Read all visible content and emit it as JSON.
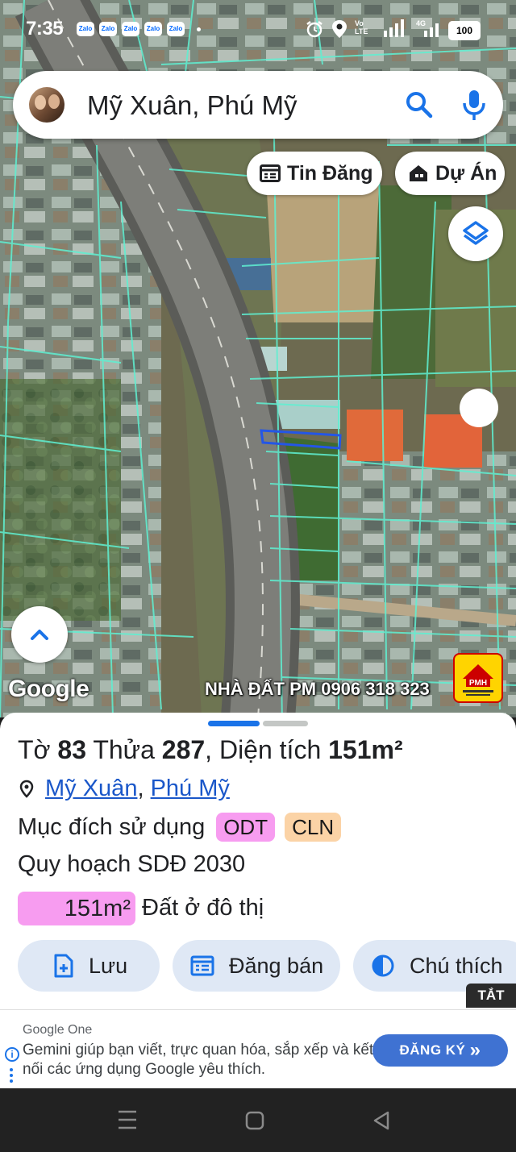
{
  "status_bar": {
    "time": "7:35",
    "notification_apps": [
      "Zalo",
      "Zalo",
      "Zalo",
      "Zalo",
      "Zalo"
    ],
    "network_label": "Vo LTE",
    "data_label": "4G",
    "battery": "100",
    "icons": [
      "alarm-icon",
      "location-icon",
      "signal-icon",
      "battery-icon"
    ]
  },
  "search": {
    "query": "Mỹ Xuân, Phú Mỹ",
    "icons": [
      "avatar",
      "search-icon",
      "mic-icon"
    ]
  },
  "chips": {
    "listings": "Tin Đăng",
    "projects": "Dự Án"
  },
  "map": {
    "attribution": "Google",
    "watermark": "NHÀ ĐẤT PM 0906 318 323",
    "logo_text": "PMH",
    "highlight_color": "#2456e6",
    "parcel_line_color": "#5ff0d2",
    "icons": [
      "layers-icon",
      "chevron-up-icon"
    ]
  },
  "parcel": {
    "sheet_label": "Tờ",
    "sheet_no": "83",
    "lot_label": "Thửa",
    "lot_no": "287",
    "area_label": ", Diện tích",
    "area": "151m²",
    "commune": "Mỹ Xuân",
    "separator": ",",
    "town": "Phú Mỹ",
    "purpose_label": "Mục đích sử dụng",
    "purposes": [
      "ODT",
      "CLN"
    ],
    "purpose_colors": [
      "#f79cf0",
      "#fbd3a6"
    ],
    "plan_label": "Quy hoạch SDĐ 2030",
    "plan_area": "151m²",
    "plan_desc": "Đất ở đô thị"
  },
  "actions": {
    "save": "Lưu",
    "post_sale": "Đăng bán",
    "legend": "Chú thích",
    "hide_ads": "TẮT QC"
  },
  "ad": {
    "source": "Google One",
    "text": "Gemini giúp bạn viết, trực quan hóa, sắp xếp và kết nối các ứng dụng Google yêu thích.",
    "cta": "ĐĂNG KÝ",
    "cta_arrow": "»",
    "info": "i"
  },
  "nav": {
    "icons": [
      "menu-icon",
      "home-icon",
      "back-icon"
    ]
  }
}
